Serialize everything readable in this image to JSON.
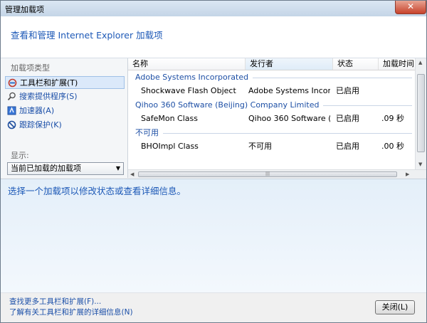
{
  "window": {
    "title": "管理加载项",
    "close_glyph": "✕"
  },
  "header": {
    "text": "查看和管理 Internet Explorer 加载项"
  },
  "left_pane": {
    "type_label": "加载项类型",
    "items": [
      {
        "label": "工具栏和扩展(T)",
        "icon": "toolbar-extension-icon"
      },
      {
        "label": "搜索提供程序(S)",
        "icon": "search-icon"
      },
      {
        "label": "加速器(A)",
        "icon": "accelerator-icon"
      },
      {
        "label": "跟踪保护(K)",
        "icon": "tracking-protection-icon"
      }
    ],
    "show_label": "显示:",
    "show_value": "当前已加载的加载项"
  },
  "list": {
    "columns": [
      "名称",
      "发行者",
      "状态",
      "加载时间"
    ],
    "groups": [
      {
        "name": "Adobe Systems Incorporated",
        "rows": [
          {
            "name": "Shockwave Flash Object",
            "publisher": "Adobe Systems Incor...",
            "status": "已启用",
            "load_time": ""
          }
        ]
      },
      {
        "name": "Qihoo 360 Software (Beijing) Company Limited",
        "rows": [
          {
            "name": "SafeMon Class",
            "publisher": "Qihoo 360 Software (...",
            "status": "已启用",
            "load_time": ".09 秒"
          }
        ]
      },
      {
        "name": "不可用",
        "rows": [
          {
            "name": "BHOImpl Class",
            "publisher": "不可用",
            "status": "已启用",
            "load_time": ".00 秒"
          }
        ]
      }
    ]
  },
  "detail": {
    "text": "选择一个加载项以修改状态或查看详细信息。"
  },
  "footer": {
    "link1": "查找更多工具栏和扩展(F)...",
    "link2": "了解有关工具栏和扩展的详细信息(N)",
    "close_label": "关闭(L)"
  }
}
